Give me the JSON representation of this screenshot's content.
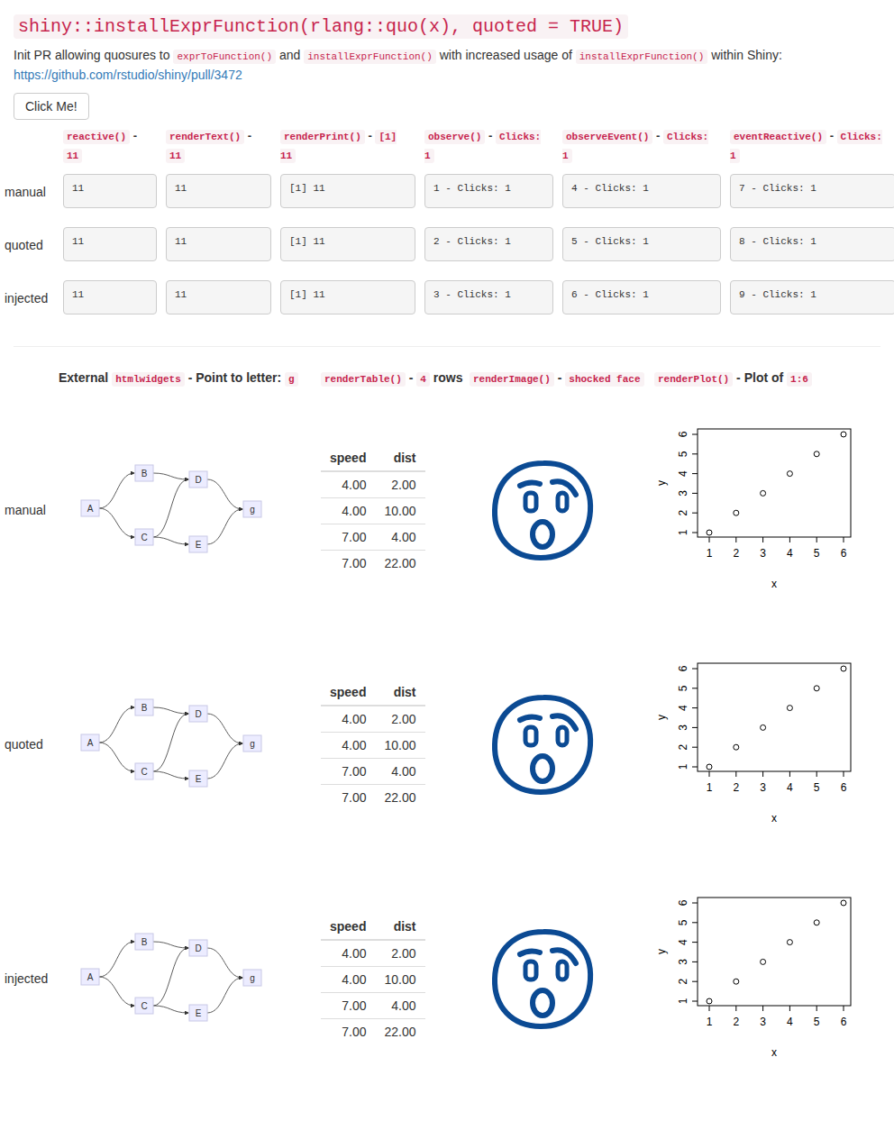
{
  "title": "shiny::installExprFunction(rlang::quo(x), quoted = TRUE)",
  "intro": {
    "segments": [
      {
        "text": "Init PR allowing quosures to ",
        "kind": "text"
      },
      {
        "text": "exprToFunction()",
        "kind": "code"
      },
      {
        "text": " and ",
        "kind": "text"
      },
      {
        "text": "installExprFunction()",
        "kind": "code"
      },
      {
        "text": " with increased usage of ",
        "kind": "text"
      },
      {
        "text": "installExprFunction()",
        "kind": "code"
      },
      {
        "text": " within Shiny:",
        "kind": "text"
      }
    ],
    "link": "https://github.com/rstudio/shiny/pull/3472"
  },
  "button": "Click Me!",
  "outputs": {
    "columns": [
      {
        "segments": [
          {
            "text": "reactive()",
            "kind": "code"
          },
          {
            "text": " - ",
            "kind": "text"
          },
          {
            "text": "11",
            "kind": "code"
          }
        ]
      },
      {
        "segments": [
          {
            "text": "renderText()",
            "kind": "code"
          },
          {
            "text": " - ",
            "kind": "text"
          },
          {
            "text": "11",
            "kind": "code"
          }
        ]
      },
      {
        "segments": [
          {
            "text": "renderPrint()",
            "kind": "code"
          },
          {
            "text": " - ",
            "kind": "text"
          },
          {
            "text": "[1] 11",
            "kind": "code"
          }
        ]
      },
      {
        "segments": [
          {
            "text": "observe()",
            "kind": "code"
          },
          {
            "text": " - ",
            "kind": "text"
          },
          {
            "text": "Clicks: 1",
            "kind": "code"
          }
        ]
      },
      {
        "segments": [
          {
            "text": "observeEvent()",
            "kind": "code"
          },
          {
            "text": " - ",
            "kind": "text"
          },
          {
            "text": "Clicks: 1",
            "kind": "code"
          }
        ]
      },
      {
        "segments": [
          {
            "text": "eventReactive()",
            "kind": "code"
          },
          {
            "text": " - ",
            "kind": "text"
          },
          {
            "text": "Clicks: 1",
            "kind": "code"
          }
        ]
      }
    ],
    "rows": [
      {
        "label": "manual",
        "cells": [
          "11",
          "11",
          "[1] 11",
          "1 - Clicks: 1",
          "4 - Clicks: 1",
          "7 - Clicks: 1"
        ]
      },
      {
        "label": "quoted",
        "cells": [
          "11",
          "11",
          "[1] 11",
          "2 - Clicks: 1",
          "5 - Clicks: 1",
          "8 - Clicks: 1"
        ]
      },
      {
        "label": "injected",
        "cells": [
          "11",
          "11",
          "[1] 11",
          "3 - Clicks: 1",
          "6 - Clicks: 1",
          "9 - Clicks: 1"
        ]
      }
    ]
  },
  "widgets": {
    "columns": [
      {
        "segments": [
          {
            "text": "External ",
            "kind": "text"
          },
          {
            "text": "htmlwidgets",
            "kind": "code"
          },
          {
            "text": " - Point to letter: ",
            "kind": "text"
          },
          {
            "text": "g",
            "kind": "code"
          }
        ]
      },
      {
        "segments": [
          {
            "text": "renderTable()",
            "kind": "code"
          },
          {
            "text": " - ",
            "kind": "text"
          },
          {
            "text": "4",
            "kind": "code"
          },
          {
            "text": " rows",
            "kind": "text"
          }
        ]
      },
      {
        "segments": [
          {
            "text": "renderImage()",
            "kind": "code"
          },
          {
            "text": " - ",
            "kind": "text"
          },
          {
            "text": "shocked face",
            "kind": "code"
          }
        ]
      },
      {
        "segments": [
          {
            "text": "renderPlot()",
            "kind": "code"
          },
          {
            "text": " - Plot of ",
            "kind": "text"
          },
          {
            "text": "1:6",
            "kind": "code"
          }
        ]
      }
    ],
    "rows": [
      {
        "label": "manual",
        "graph": {
          "nodes": [
            "A",
            "B",
            "C",
            "D",
            "E",
            "g"
          ],
          "edges": [
            [
              "A",
              "B"
            ],
            [
              "A",
              "C"
            ],
            [
              "B",
              "D"
            ],
            [
              "C",
              "D"
            ],
            [
              "C",
              "E"
            ],
            [
              "D",
              "g"
            ],
            [
              "E",
              "g"
            ]
          ]
        },
        "table": {
          "columns": [
            "speed",
            "dist"
          ],
          "rows": [
            [
              "4.00",
              "2.00"
            ],
            [
              "4.00",
              "10.00"
            ],
            [
              "7.00",
              "4.00"
            ],
            [
              "7.00",
              "22.00"
            ]
          ]
        },
        "plot": {
          "series": [
            {
              "values": [
                1,
                2,
                3,
                4,
                5,
                6
              ]
            }
          ],
          "x_ticks": [
            "1",
            "2",
            "3",
            "4",
            "5",
            "6"
          ],
          "y_ticks": [
            "1",
            "2",
            "3",
            "4",
            "5",
            "6"
          ],
          "x_label": "x",
          "y_label": "y"
        }
      },
      {
        "label": "quoted",
        "graph": {
          "nodes": [
            "A",
            "B",
            "C",
            "D",
            "E",
            "g"
          ],
          "edges": [
            [
              "A",
              "B"
            ],
            [
              "A",
              "C"
            ],
            [
              "B",
              "D"
            ],
            [
              "C",
              "D"
            ],
            [
              "C",
              "E"
            ],
            [
              "D",
              "g"
            ],
            [
              "E",
              "g"
            ]
          ]
        },
        "table": {
          "columns": [
            "speed",
            "dist"
          ],
          "rows": [
            [
              "4.00",
              "2.00"
            ],
            [
              "4.00",
              "10.00"
            ],
            [
              "7.00",
              "4.00"
            ],
            [
              "7.00",
              "22.00"
            ]
          ]
        },
        "plot": {
          "series": [
            {
              "values": [
                1,
                2,
                3,
                4,
                5,
                6
              ]
            }
          ],
          "x_ticks": [
            "1",
            "2",
            "3",
            "4",
            "5",
            "6"
          ],
          "y_ticks": [
            "1",
            "2",
            "3",
            "4",
            "5",
            "6"
          ],
          "x_label": "x",
          "y_label": "y"
        }
      },
      {
        "label": "injected",
        "graph": {
          "nodes": [
            "A",
            "B",
            "C",
            "D",
            "E",
            "g"
          ],
          "edges": [
            [
              "A",
              "B"
            ],
            [
              "A",
              "C"
            ],
            [
              "B",
              "D"
            ],
            [
              "C",
              "D"
            ],
            [
              "C",
              "E"
            ],
            [
              "D",
              "g"
            ],
            [
              "E",
              "g"
            ]
          ]
        },
        "table": {
          "columns": [
            "speed",
            "dist"
          ],
          "rows": [
            [
              "4.00",
              "2.00"
            ],
            [
              "4.00",
              "10.00"
            ],
            [
              "7.00",
              "4.00"
            ],
            [
              "7.00",
              "22.00"
            ]
          ]
        },
        "plot": {
          "series": [
            {
              "values": [
                1,
                2,
                3,
                4,
                5,
                6
              ]
            }
          ],
          "x_ticks": [
            "1",
            "2",
            "3",
            "4",
            "5",
            "6"
          ],
          "y_ticks": [
            "1",
            "2",
            "3",
            "4",
            "5",
            "6"
          ],
          "x_label": "x",
          "y_label": "y"
        }
      }
    ]
  }
}
